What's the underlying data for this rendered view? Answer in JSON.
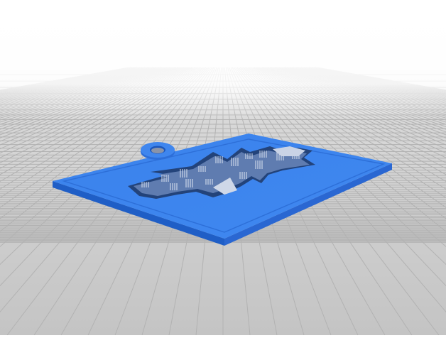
{
  "scene": {
    "background_top": "#ffffff",
    "background_floor": "#c9c9c9",
    "grid_line_color": "#b4b4b4",
    "model_top_color": "#3f86ee",
    "model_side_color": "#1e5fc8",
    "model_edge_color": "#2f72dc",
    "relief_shadow_color": "#7c8aa6"
  }
}
